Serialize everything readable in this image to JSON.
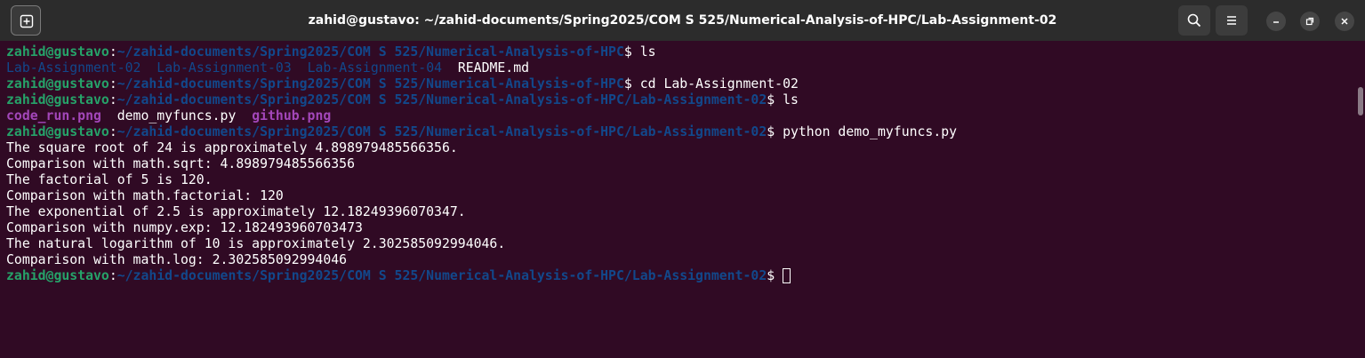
{
  "window": {
    "title": "zahid@gustavo: ~/zahid-documents/Spring2025/COM S 525/Numerical-Analysis-of-HPC/Lab-Assignment-02"
  },
  "titlebar": {
    "new_tab_icon": "new-tab-icon",
    "search_icon": "search-icon",
    "menu_icon": "hamburger-menu-icon",
    "minimize_icon": "minimize-icon",
    "maximize_icon": "maximize-icon",
    "close_icon": "close-icon"
  },
  "colors": {
    "background": "#300a24",
    "user": "#26a269",
    "path": "#12488b",
    "image_file": "#a347ba",
    "text": "#ffffff"
  },
  "prompt": {
    "user": "zahid@gustavo",
    "colon": ":",
    "dollar": "$ "
  },
  "terminal": {
    "line1": {
      "path": "~/zahid-documents/Spring2025/COM S 525/Numerical-Analysis-of-HPC",
      "cmd": "ls"
    },
    "ls1": {
      "item1": "Lab-Assignment-02",
      "item2": "Lab-Assignment-03",
      "item3": "Lab-Assignment-04",
      "item4": "README.md"
    },
    "line3": {
      "path": "~/zahid-documents/Spring2025/COM S 525/Numerical-Analysis-of-HPC",
      "cmd": "cd Lab-Assignment-02"
    },
    "line4": {
      "path": "~/zahid-documents/Spring2025/COM S 525/Numerical-Analysis-of-HPC/Lab-Assignment-02",
      "cmd": "ls"
    },
    "ls2": {
      "item1": "code_run.png",
      "item2": "demo_myfuncs.py",
      "item3": "github.png"
    },
    "line6": {
      "path": "~/zahid-documents/Spring2025/COM S 525/Numerical-Analysis-of-HPC/Lab-Assignment-02",
      "cmd": "python demo_myfuncs.py"
    },
    "output": [
      "The square root of 24 is approximately 4.898979485566356.",
      "Comparison with math.sqrt: 4.898979485566356",
      "The factorial of 5 is 120.",
      "Comparison with math.factorial: 120",
      "The exponential of 2.5 is approximately 12.18249396070347.",
      "Comparison with numpy.exp: 12.182493960703473",
      "The natural logarithm of 10 is approximately 2.302585092994046.",
      "Comparison with math.log: 2.302585092994046"
    ],
    "line15": {
      "path": "~/zahid-documents/Spring2025/COM S 525/Numerical-Analysis-of-HPC/Lab-Assignment-02",
      "cmd": ""
    }
  }
}
